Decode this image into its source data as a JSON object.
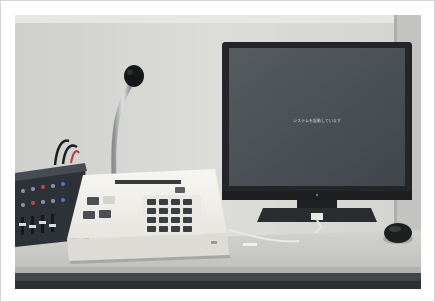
{
  "photo": {
    "monitor_screen_text": "システムを起動しています"
  },
  "colors": {
    "wall": "#d9d9d6",
    "desk": "#c9cac6",
    "desk_front": "#3f4549",
    "panel_white": "#f2f1ec",
    "monitor_frame": "#232528",
    "monitor_screen": "#4b5055",
    "mixer_dark": "#2d3238"
  }
}
